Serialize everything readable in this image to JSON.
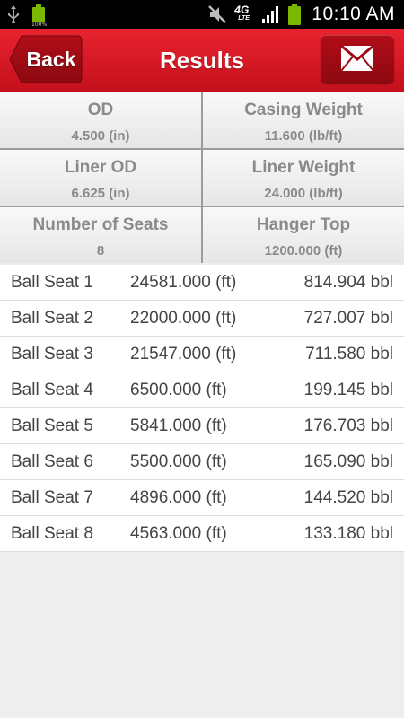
{
  "status_bar": {
    "time": "10:10 AM",
    "battery_small_label": "100%",
    "network_label_top": "4G",
    "network_label_bottom": "LTE"
  },
  "header": {
    "back_label": "Back",
    "title": "Results"
  },
  "info": [
    {
      "label": "OD",
      "value": "4.500 (in)"
    },
    {
      "label": "Casing Weight",
      "value": "11.600 (lb/ft)"
    },
    {
      "label": "Liner OD",
      "value": "6.625 (in)"
    },
    {
      "label": "Liner Weight",
      "value": "24.000 (lb/ft)"
    },
    {
      "label": "Number of Seats",
      "value": "8"
    },
    {
      "label": "Hanger Top",
      "value": "1200.000 (ft)"
    }
  ],
  "seats": [
    {
      "name": "Ball Seat 1",
      "depth": "24581.000 (ft)",
      "volume": "814.904 bbl"
    },
    {
      "name": "Ball Seat 2",
      "depth": "22000.000 (ft)",
      "volume": "727.007 bbl"
    },
    {
      "name": "Ball Seat 3",
      "depth": "21547.000 (ft)",
      "volume": "711.580 bbl"
    },
    {
      "name": "Ball Seat 4",
      "depth": "6500.000 (ft)",
      "volume": "199.145 bbl"
    },
    {
      "name": "Ball Seat 5",
      "depth": "5841.000 (ft)",
      "volume": "176.703 bbl"
    },
    {
      "name": "Ball Seat 6",
      "depth": "5500.000 (ft)",
      "volume": "165.090 bbl"
    },
    {
      "name": "Ball Seat 7",
      "depth": "4896.000 (ft)",
      "volume": "144.520 bbl"
    },
    {
      "name": "Ball Seat 8",
      "depth": "4563.000 (ft)",
      "volume": "133.180 bbl"
    }
  ],
  "colors": {
    "header_red": "#d61a26",
    "battery_green": "#7ab800"
  }
}
